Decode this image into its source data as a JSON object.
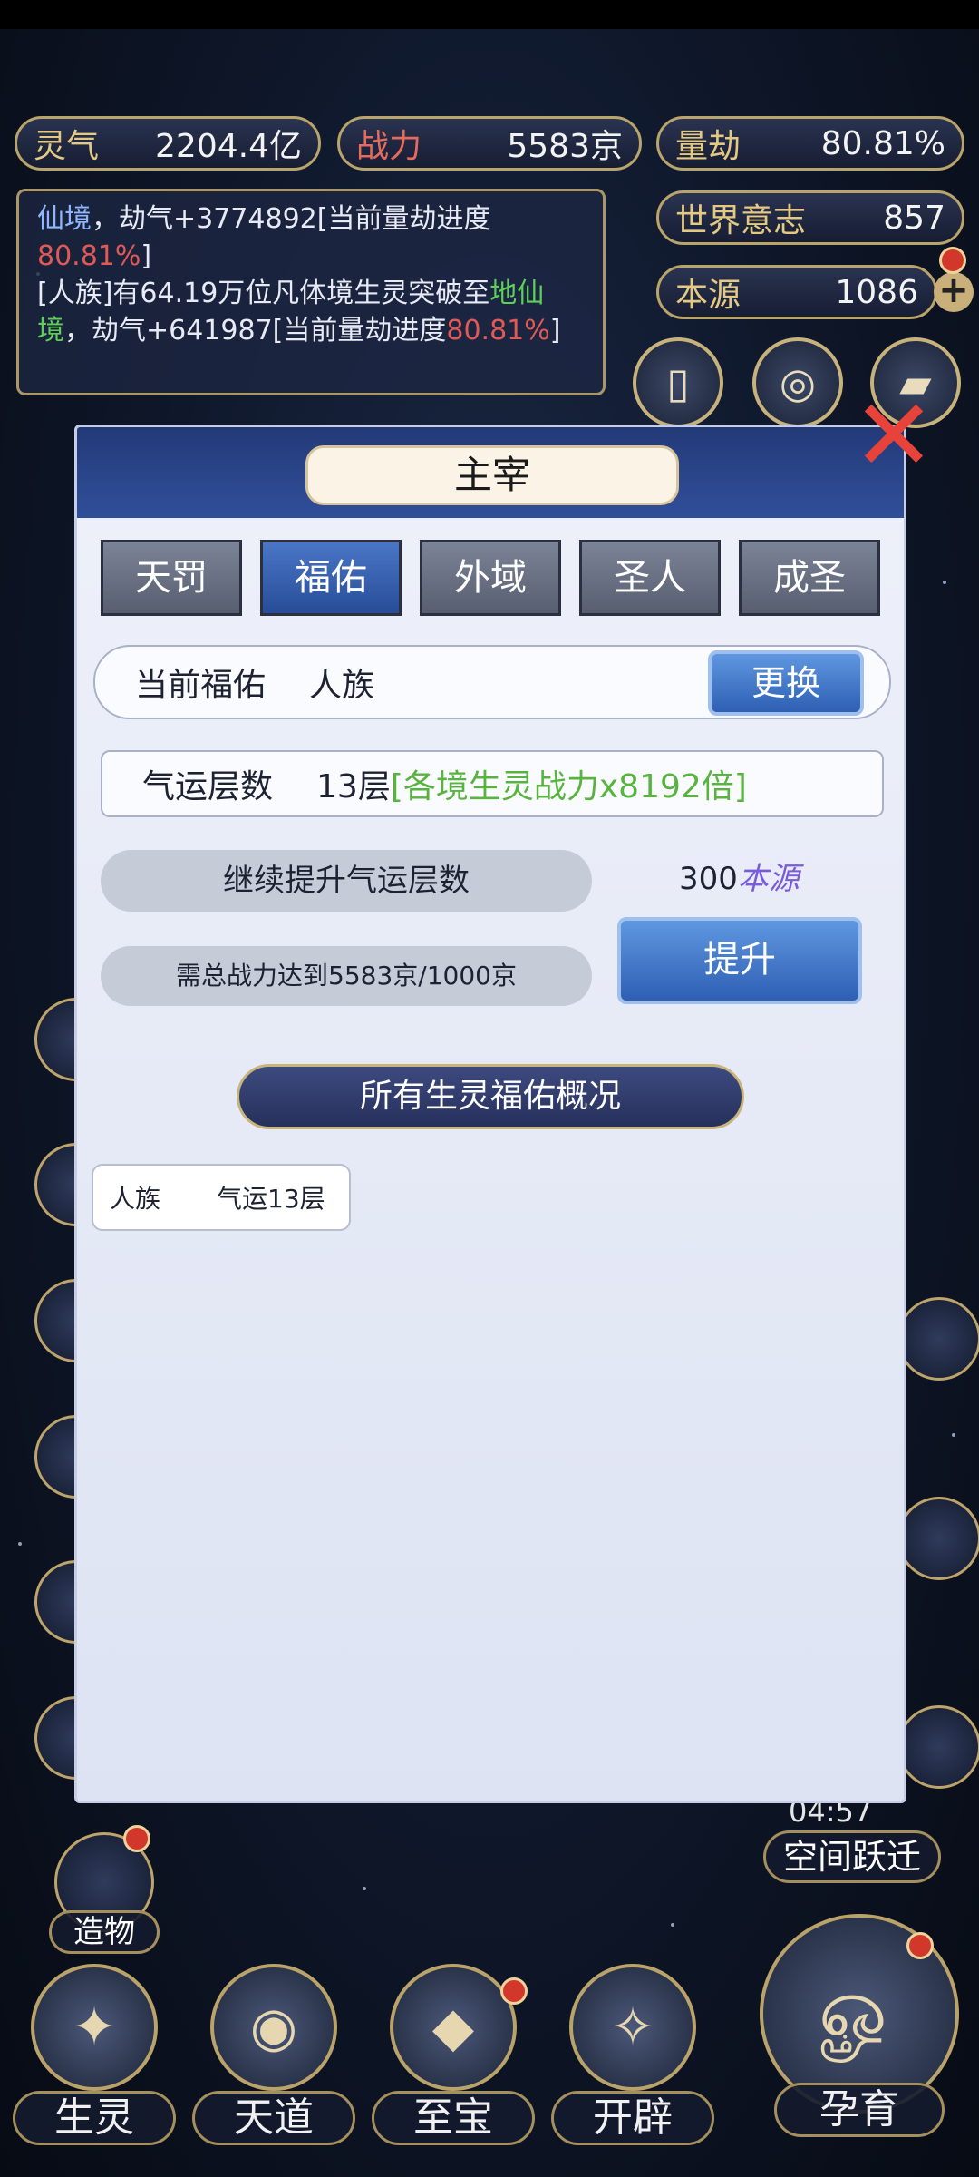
{
  "resources": {
    "lingqi": {
      "label": "灵气",
      "value": "2204.4亿"
    },
    "zhanli": {
      "label": "战力",
      "value": "5583京"
    },
    "liangjie": {
      "label": "量劫",
      "value": "80.81%"
    },
    "shijie": {
      "label": "世界意志",
      "value": "857"
    },
    "benyuan": {
      "label": "本源",
      "value": "1086"
    }
  },
  "log": {
    "line1_a": "仙境",
    "line1_b": "，劫气+3774892[当前量劫进度",
    "line1_c": "80.81%",
    "line1_d": "]",
    "line2_a": "[人族]有64.19万位凡体境生灵突破至",
    "line2_b": "地",
    "line2_c": "仙境",
    "line2_d": "，劫气+641987[当前量劫进度",
    "line2_e": "80.81%",
    "line2_f": "]"
  },
  "dialog": {
    "title": "主宰",
    "tabs": [
      {
        "label": "天罚"
      },
      {
        "label": "福佑"
      },
      {
        "label": "外域"
      },
      {
        "label": "圣人"
      },
      {
        "label": "成圣"
      }
    ],
    "active_tab": "福佑",
    "current": {
      "label": "当前福佑",
      "value": "人族",
      "swap_button": "更换"
    },
    "fortune": {
      "label": "气运层数",
      "value": "13层",
      "bonus": "[各境生灵战力x8192倍]"
    },
    "upgrade": {
      "title": "继续提升气运层数",
      "requirement": "需总战力达到5583京/1000京",
      "cost_amount": "300",
      "cost_unit": "本源",
      "button": "提升"
    },
    "overview_banner": "所有生灵福佑概况",
    "overview_items": [
      {
        "race": "人族",
        "fortune": "气运13层"
      }
    ]
  },
  "side_right": {
    "timer": "04:57",
    "label": "空间跃迁"
  },
  "side_left": {
    "label": "造物"
  },
  "bottom_nav": [
    {
      "label": "生灵"
    },
    {
      "label": "天道"
    },
    {
      "label": "至宝"
    },
    {
      "label": "开辟"
    },
    {
      "label": "孕育"
    }
  ],
  "colors": {
    "accent_gold": "#c7b27c",
    "alert_red": "#e05a55",
    "highlight_green": "#58b43f"
  }
}
